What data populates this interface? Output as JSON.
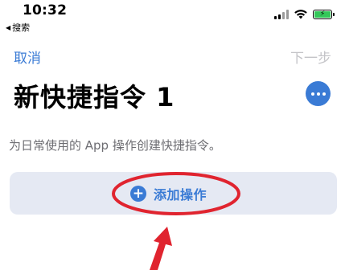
{
  "status_bar": {
    "time": "10:32",
    "back_app": "搜索",
    "back_arrow": "◀",
    "battery_bolt": "⚡",
    "battery_color": "#34c759"
  },
  "nav": {
    "cancel_label": "取消",
    "next_label": "下一步"
  },
  "page": {
    "title": "新快捷指令 1",
    "description": "为日常使用的 App 操作创建快捷指令。",
    "add_action_label": "添加操作",
    "more_icon": "ellipsis-icon"
  },
  "annotation": {
    "ellipse_color": "#e0242f",
    "arrow_color": "#e0242f"
  },
  "colors": {
    "accent": "#3a7bd5",
    "disabled": "#c4c4c8",
    "card_bg": "#e5e9f3"
  }
}
